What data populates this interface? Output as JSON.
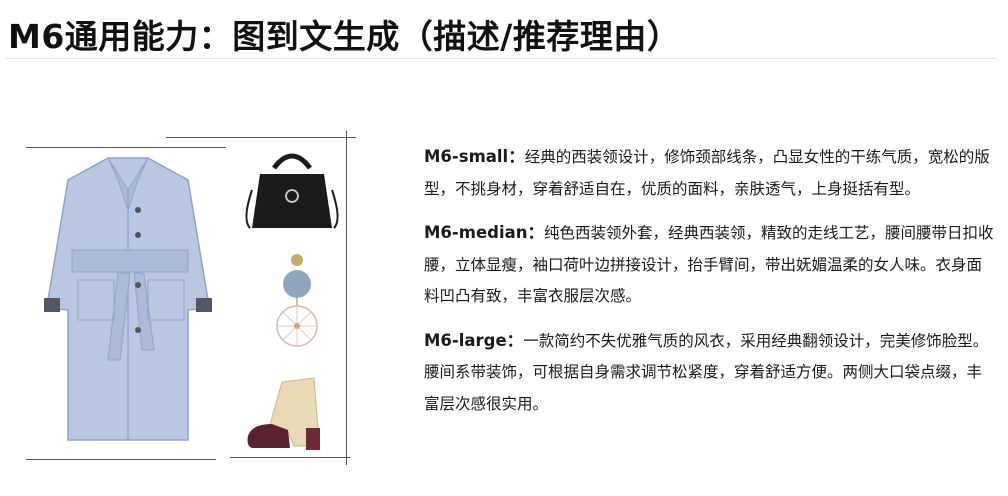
{
  "title": "M6通用能力：图到文生成（描述/推荐理由）",
  "figures": {
    "coat": "coat-illustration",
    "bag": "handbag-illustration",
    "earring": "earring-illustration",
    "boot": "ankle-boot-illustration"
  },
  "descriptions": [
    {
      "model": "M6-small：",
      "text": "经典的西装领设计，修饰颈部线条，凸显女性的干练气质，宽松的版型，不挑身材，穿着舒适自在，优质的面料，亲肤透气，上身挺括有型。"
    },
    {
      "model": "M6-median：",
      "text": "纯色西装领外套，经典西装领，精致的走线工艺，腰间腰带日扣收腰，立体显瘦，袖口荷叶边拼接设计，抬手臂间，带出妩媚温柔的女人味。衣身面料凹凸有致，丰富衣服层次感。"
    },
    {
      "model": "M6-large：",
      "text": "一款简约不失优雅气质的风衣，采用经典翻领设计，完美修饰脸型。腰间系带装饰，可根据自身需求调节松紧度，穿着舒适方便。两侧大口袋点缀，丰富层次感很实用。"
    }
  ],
  "colors": {
    "coat": "#b9c8e2",
    "coat_shadow": "#9eb1d2",
    "bag": "#1b1b1b",
    "earring_ball": "#8fa7be",
    "earring_gold": "#caa86a",
    "boot_upper": "#ead9b5",
    "boot_toe": "#5a2230",
    "boot_heel": "#6d2b34"
  }
}
